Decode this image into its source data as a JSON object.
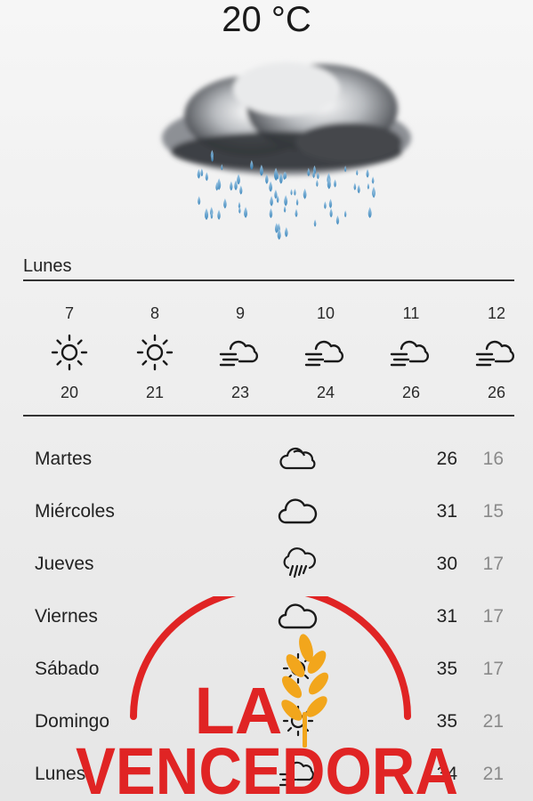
{
  "current": {
    "temperature": "20 °C",
    "icon": "heavy-rain-cloud-icon"
  },
  "today": {
    "label": "Lunes"
  },
  "hourly": [
    {
      "time": "7",
      "icon": "sun-icon",
      "temp": "20"
    },
    {
      "time": "8",
      "icon": "sun-icon",
      "temp": "21"
    },
    {
      "time": "9",
      "icon": "windy-cloud-icon",
      "temp": "23"
    },
    {
      "time": "10",
      "icon": "windy-cloud-icon",
      "temp": "24"
    },
    {
      "time": "11",
      "icon": "windy-cloud-icon",
      "temp": "26"
    },
    {
      "time": "12",
      "icon": "windy-cloud-icon",
      "temp": "26"
    }
  ],
  "daily": [
    {
      "day": "Martes",
      "icon": "cloud-outline-icon",
      "high": "26",
      "low": "16"
    },
    {
      "day": "Miércoles",
      "icon": "cloud-icon",
      "high": "31",
      "low": "15"
    },
    {
      "day": "Jueves",
      "icon": "rain-cloud-icon",
      "high": "30",
      "low": "17"
    },
    {
      "day": "Viernes",
      "icon": "cloud-icon",
      "high": "31",
      "low": "17"
    },
    {
      "day": "Sábado",
      "icon": "sun-icon",
      "high": "35",
      "low": "17"
    },
    {
      "day": "Domingo",
      "icon": "sun-icon",
      "high": "35",
      "low": "21"
    },
    {
      "day": "Lunes",
      "icon": "windy-cloud-icon",
      "high": "34",
      "low": "21"
    }
  ],
  "watermark": {
    "line1": "LA",
    "line2": "VENCEDORA",
    "color": "#e02424",
    "wheat_color": "#f2a61c"
  }
}
